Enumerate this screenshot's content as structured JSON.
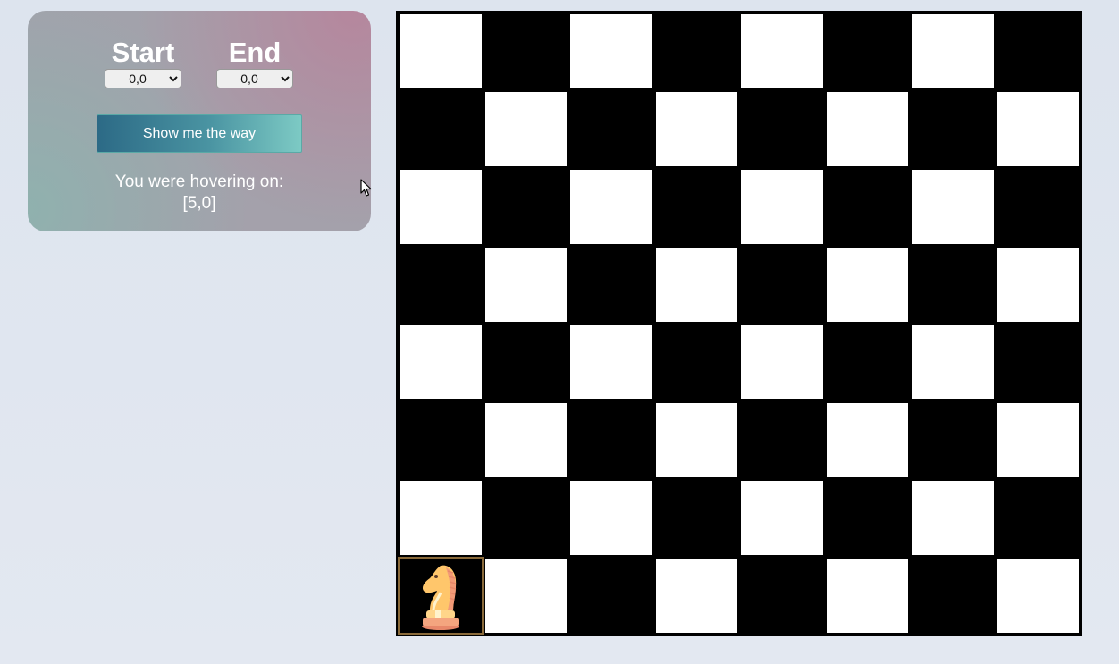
{
  "panel": {
    "start_label": "Start",
    "end_label": "End",
    "start_value": "0,0",
    "end_value": "0,0",
    "button_label": "Show me the way",
    "hover_label": "You were hovering on:",
    "hover_value": "[5,0]"
  },
  "board": {
    "rows": 8,
    "cols": 8,
    "piece": "knight-icon",
    "piece_row": 7,
    "piece_col": 0,
    "light_color": "#ffffff",
    "dark_color": "#000000"
  }
}
